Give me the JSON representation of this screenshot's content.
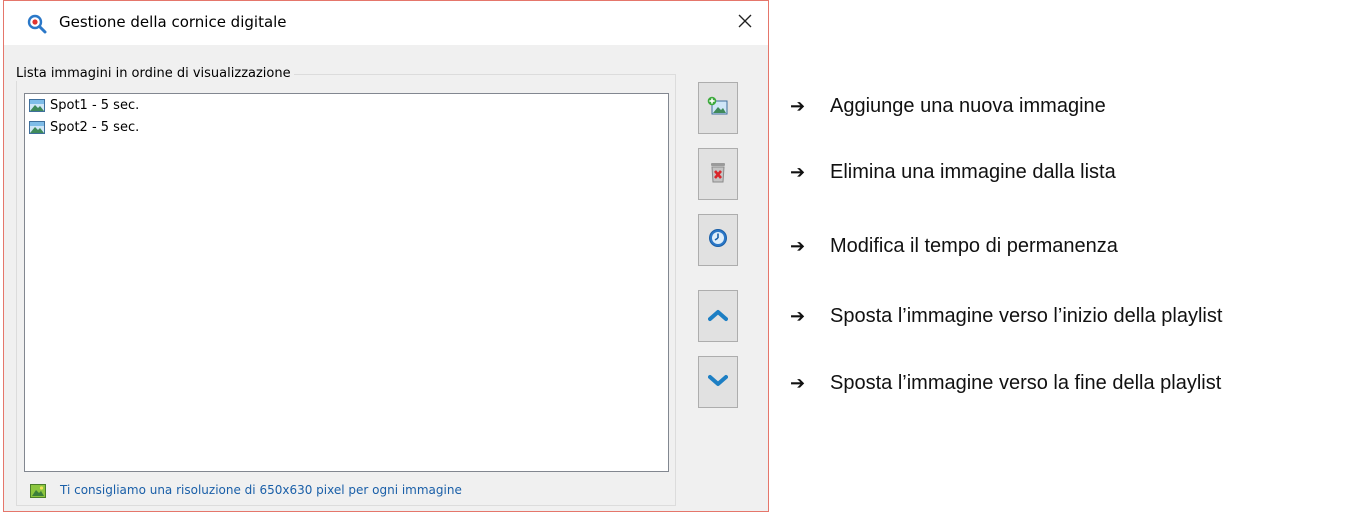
{
  "window": {
    "title": "Gestione della cornice digitale",
    "icon": "search-magnifier-icon",
    "close_icon": "close-icon"
  },
  "group": {
    "label": "Lista immagini in ordine di visualizzazione"
  },
  "list": {
    "items": [
      {
        "label": "Spot1 - 5 sec.",
        "icon": "image-icon"
      },
      {
        "label": "Spot2 - 5 sec.",
        "icon": "image-icon"
      }
    ]
  },
  "hint": {
    "text": "Ti consigliamo una risoluzione di 650x630 pixel per ogni immagine",
    "icon": "image-icon"
  },
  "buttons": [
    {
      "icon": "add-image-icon"
    },
    {
      "icon": "delete-trash-icon"
    },
    {
      "icon": "clock-icon"
    },
    {
      "icon": "chevron-up-icon"
    },
    {
      "icon": "chevron-down-icon"
    }
  ],
  "annotations": [
    {
      "arrow": "➔",
      "text": "Aggiunge una nuova immagine"
    },
    {
      "arrow": "➔",
      "text": "Elimina una immagine dalla lista"
    },
    {
      "arrow": "➔",
      "text": "Modifica il tempo di permanenza"
    },
    {
      "arrow": "➔",
      "text": "Sposta l’immagine verso l’inizio della playlist"
    },
    {
      "arrow": "➔",
      "text": "Sposta l’immagine verso la fine della playlist"
    }
  ],
  "colors": {
    "window_border": "#e5766b",
    "hint_text": "#1a5fa8",
    "chevron_blue": "#1d7fc4",
    "delete_red": "#d9262b"
  }
}
